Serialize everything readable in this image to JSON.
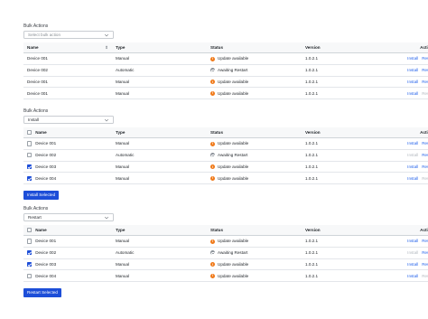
{
  "colors": {
    "accent": "#1d4ed8",
    "link": "#2563eb",
    "warning": "#f07a1a",
    "neutral": "#8d939a"
  },
  "columns": {
    "name": "Name",
    "type": "Type",
    "status": "Status",
    "version": "Version",
    "actions": "Actions"
  },
  "actions": {
    "install": "Install",
    "restart": "Restart"
  },
  "section1": {
    "label": "Bulk Actions",
    "select_placeholder": "Select bulk action",
    "rows": [
      {
        "name": "Device 001",
        "type": "Manual",
        "status": "Update available",
        "status_kind": "warning",
        "version": "1.0.2.1",
        "install_enabled": true,
        "restart_enabled": true
      },
      {
        "name": "Device 002",
        "type": "Automatic",
        "status": "Awaiting Restart",
        "status_kind": "waiting",
        "version": "1.0.2.1",
        "install_enabled": true,
        "restart_enabled": true
      },
      {
        "name": "Device 001",
        "type": "Manual",
        "status": "Update available",
        "status_kind": "warning",
        "version": "1.0.2.1",
        "install_enabled": true,
        "restart_enabled": true
      },
      {
        "name": "Device 001",
        "type": "Manual",
        "status": "Update available",
        "status_kind": "warning",
        "version": "1.0.2.1",
        "install_enabled": true,
        "restart_enabled": false
      }
    ]
  },
  "section2": {
    "label": "Bulk Actions",
    "select_value": "Install",
    "button": "Install Selected",
    "rows": [
      {
        "name": "Device 001",
        "checked": false,
        "type": "Manual",
        "status": "Update available",
        "status_kind": "warning",
        "version": "1.0.2.1",
        "install_enabled": true,
        "restart_enabled": true
      },
      {
        "name": "Device 002",
        "checked": false,
        "type": "Automatic",
        "status": "Awaiting Restart",
        "status_kind": "waiting",
        "version": "1.0.2.1",
        "install_enabled": false,
        "restart_enabled": true
      },
      {
        "name": "Device 003",
        "checked": true,
        "type": "Manual",
        "status": "Update available",
        "status_kind": "warning",
        "version": "1.0.2.1",
        "install_enabled": true,
        "restart_enabled": true
      },
      {
        "name": "Device 004",
        "checked": true,
        "type": "Manual",
        "status": "Update available",
        "status_kind": "warning",
        "version": "1.0.2.1",
        "install_enabled": true,
        "restart_enabled": false
      }
    ]
  },
  "section3": {
    "label": "Bulk Actions",
    "select_value": "Restart",
    "button": "Restart Selected",
    "rows": [
      {
        "name": "Device 001",
        "checked": false,
        "type": "Manual",
        "status": "Update available",
        "status_kind": "warning",
        "version": "1.0.2.1",
        "install_enabled": true,
        "restart_enabled": true
      },
      {
        "name": "Device 002",
        "checked": true,
        "type": "Automatic",
        "status": "Awaiting Restart",
        "status_kind": "waiting",
        "version": "1.0.2.1",
        "install_enabled": false,
        "restart_enabled": true
      },
      {
        "name": "Device 003",
        "checked": true,
        "type": "Manual",
        "status": "Update available",
        "status_kind": "warning",
        "version": "1.0.2.1",
        "install_enabled": true,
        "restart_enabled": true
      },
      {
        "name": "Device 004",
        "checked": false,
        "type": "Manual",
        "status": "Update available",
        "status_kind": "warning",
        "version": "1.0.2.1",
        "install_enabled": true,
        "restart_enabled": false
      }
    ]
  }
}
